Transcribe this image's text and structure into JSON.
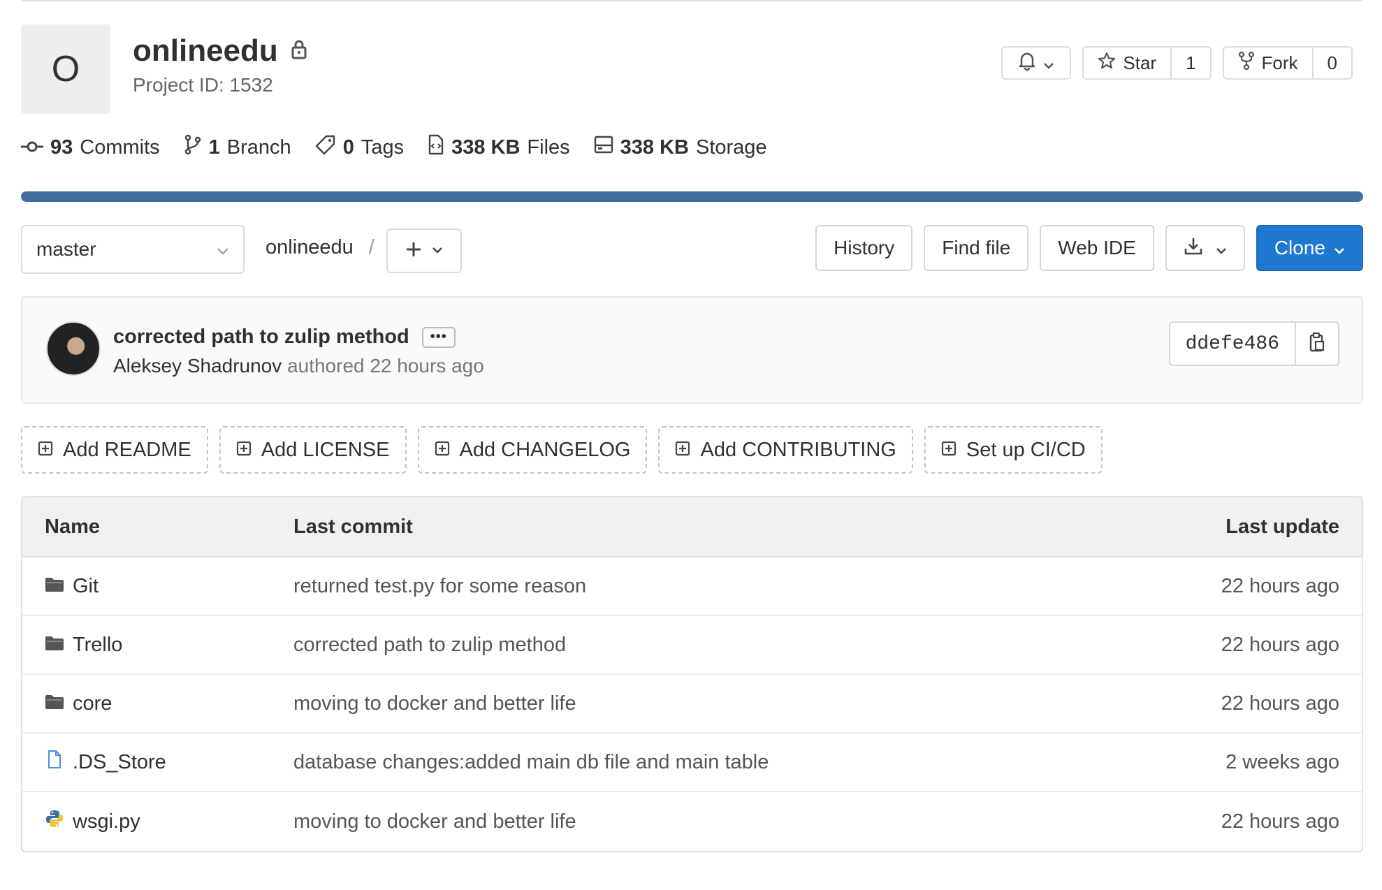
{
  "project": {
    "avatar_letter": "O",
    "name": "onlineedu",
    "project_id": "Project ID: 1532"
  },
  "header_buttons": {
    "star_label": "Star",
    "star_count": "1",
    "fork_label": "Fork",
    "fork_count": "0"
  },
  "stats": [
    {
      "value": "93",
      "label": "Commits",
      "icon": "commit-icon"
    },
    {
      "value": "1",
      "label": "Branch",
      "icon": "branch-icon"
    },
    {
      "value": "0",
      "label": "Tags",
      "icon": "tag-icon"
    },
    {
      "value": "338 KB",
      "label": "Files",
      "icon": "file-icon"
    },
    {
      "value": "338 KB",
      "label": "Storage",
      "icon": "storage-icon"
    }
  ],
  "colors": {
    "accent": "#1f78d1",
    "progress": "#3f6e9e"
  },
  "toolbar": {
    "branch": "master",
    "breadcrumb_root": "onlineedu",
    "breadcrumb_sep": "/",
    "history": "History",
    "find_file": "Find file",
    "web_ide": "Web IDE",
    "clone": "Clone"
  },
  "last_commit": {
    "title": "corrected path to zulip method",
    "ellipsis": "•••",
    "author": "Aleksey Shadrunov",
    "meta": "authored 22 hours ago",
    "sha": "ddefe486"
  },
  "suggestions": [
    "Add README",
    "Add LICENSE",
    "Add CHANGELOG",
    "Add CONTRIBUTING",
    "Set up CI/CD"
  ],
  "table": {
    "headers": {
      "name": "Name",
      "commit": "Last commit",
      "update": "Last update"
    },
    "rows": [
      {
        "name": "Git",
        "type": "folder",
        "commit": "returned test.py for some reason",
        "update": "22 hours ago"
      },
      {
        "name": "Trello",
        "type": "folder",
        "commit": "corrected path to zulip method",
        "update": "22 hours ago"
      },
      {
        "name": "core",
        "type": "folder",
        "commit": "moving to docker and better life",
        "update": "22 hours ago"
      },
      {
        "name": ".DS_Store",
        "type": "file",
        "commit": "database changes:added main db file and main table",
        "update": "2 weeks ago"
      },
      {
        "name": "wsgi.py",
        "type": "python",
        "commit": "moving to docker and better life",
        "update": "22 hours ago"
      }
    ]
  }
}
